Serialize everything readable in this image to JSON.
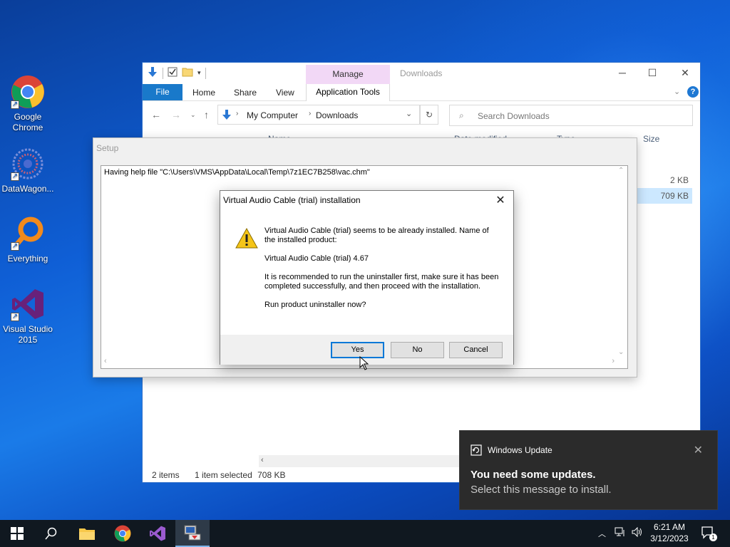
{
  "desktop": {
    "icons": [
      {
        "label": "Google Chrome",
        "icon": "chrome-icon"
      },
      {
        "label": "DataWagon...",
        "icon": "datawagon-icon"
      },
      {
        "label": "Everything",
        "icon": "everything-search-icon"
      },
      {
        "label": "Visual Studio 2015",
        "icon": "visual-studio-icon"
      }
    ]
  },
  "explorer": {
    "title": "Downloads",
    "manage_tab": "Manage",
    "tabs": {
      "file": "File",
      "home": "Home",
      "share": "Share",
      "view": "View",
      "app_tools": "Application Tools"
    },
    "breadcrumb": [
      "My Computer",
      "Downloads"
    ],
    "search_placeholder": "Search Downloads",
    "columns": {
      "name": "Name",
      "date": "Date modified",
      "type": "Type",
      "size": "Size"
    },
    "files": [
      {
        "size": "2 KB",
        "selected": false
      },
      {
        "size": "709 KB",
        "selected": true
      }
    ],
    "status": {
      "items": "2 items",
      "selected": "1 item selected",
      "selected_size": "708 KB"
    }
  },
  "setup": {
    "title": "Setup",
    "log_text": "Having help file \"C:\\Users\\VMS\\AppData\\Local\\Temp\\7z1EC7B258\\vac.chm\""
  },
  "dialog": {
    "title": "Virtual Audio Cable (trial) installation",
    "message_1": "Virtual Audio Cable (trial) seems to be already installed. Name of the installed product:",
    "message_2": "Virtual Audio Cable (trial) 4.67",
    "message_3": "It is recommended to run the uninstaller first, make sure it has been completed successfully, and then proceed with the installation.",
    "message_4": "Run product uninstaller now?",
    "buttons": {
      "yes": "Yes",
      "no": "No",
      "cancel": "Cancel"
    }
  },
  "notification": {
    "app": "Windows Update",
    "heading": "You need some updates.",
    "body": "Select this message to install."
  },
  "taskbar": {
    "time": "6:21 AM",
    "date": "3/12/2023",
    "notification_count": "1"
  },
  "colors": {
    "accent": "#0078d7",
    "file_tab": "#1979ca",
    "manage_tab": "#f2d8f6",
    "toast_bg": "#2b2b2b",
    "taskbar_bg": "#101820"
  }
}
